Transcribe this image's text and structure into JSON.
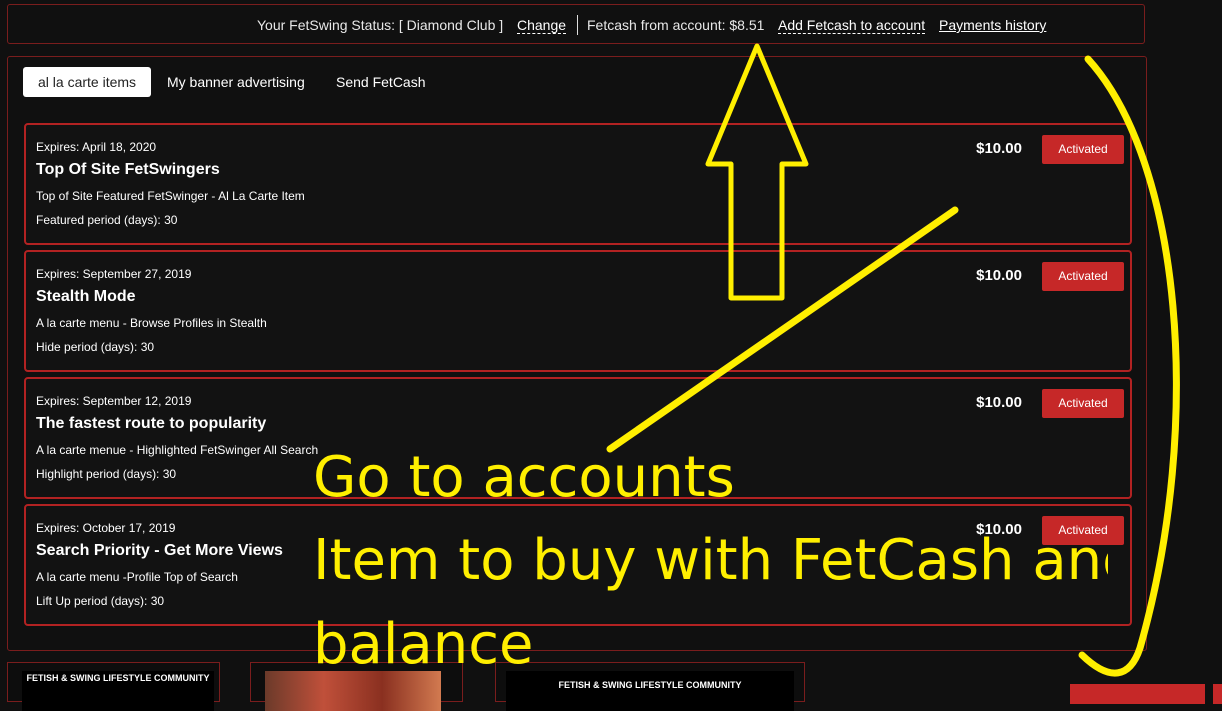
{
  "status_bar": {
    "status_label": "Your FetSwing Status: [ Diamond Club ]",
    "change_link": "Change",
    "fetcash_label": "Fetcash from account: $8.51",
    "add_fetcash_link": "Add Fetcash to account",
    "payments_history_link": "Payments history"
  },
  "tabs": [
    {
      "label": "al la carte items",
      "active": true
    },
    {
      "label": "My banner advertising",
      "active": false
    },
    {
      "label": "Send FetCash",
      "active": false
    }
  ],
  "items": [
    {
      "expires": "Expires:  April 18, 2020",
      "title": "Top Of Site FetSwingers",
      "description": "Top of Site Featured FetSwinger - Al La Carte Item",
      "period": "Featured period (days): 30",
      "price": "$10.00",
      "button": "Activated"
    },
    {
      "expires": "Expires:  September 27, 2019",
      "title": "Stealth Mode",
      "description": "A la carte menu - Browse Profiles in Stealth",
      "period": "Hide period (days): 30",
      "price": "$10.00",
      "button": "Activated"
    },
    {
      "expires": "Expires:  September 12, 2019",
      "title": "The fastest route to popularity",
      "description": "A la carte menue - Highlighted FetSwinger All Search",
      "period": "Highlight period (days): 30",
      "price": "$10.00",
      "button": "Activated"
    },
    {
      "expires": "Expires:  October 17, 2019",
      "title": "Search Priority - Get More Views",
      "description": "A la carte menu -Profile Top of Search",
      "period": "Lift Up period (days): 30",
      "price": "$10.00",
      "button": "Activated"
    }
  ],
  "bottom_banners": [
    {
      "text": "FETISH & SWING LIFESTYLE COMMUNITY"
    },
    {
      "text": ""
    },
    {
      "text": "FETISH & SWING LIFESTYLE COMMUNITY"
    }
  ],
  "annotation": {
    "line1": "Go to accounts",
    "line2": "Item to buy with FetCash and",
    "line3": "balance",
    "color": "#ffef00"
  },
  "colors": {
    "accent_red": "#c62828",
    "border_red": "#b22222",
    "background": "#101010"
  }
}
